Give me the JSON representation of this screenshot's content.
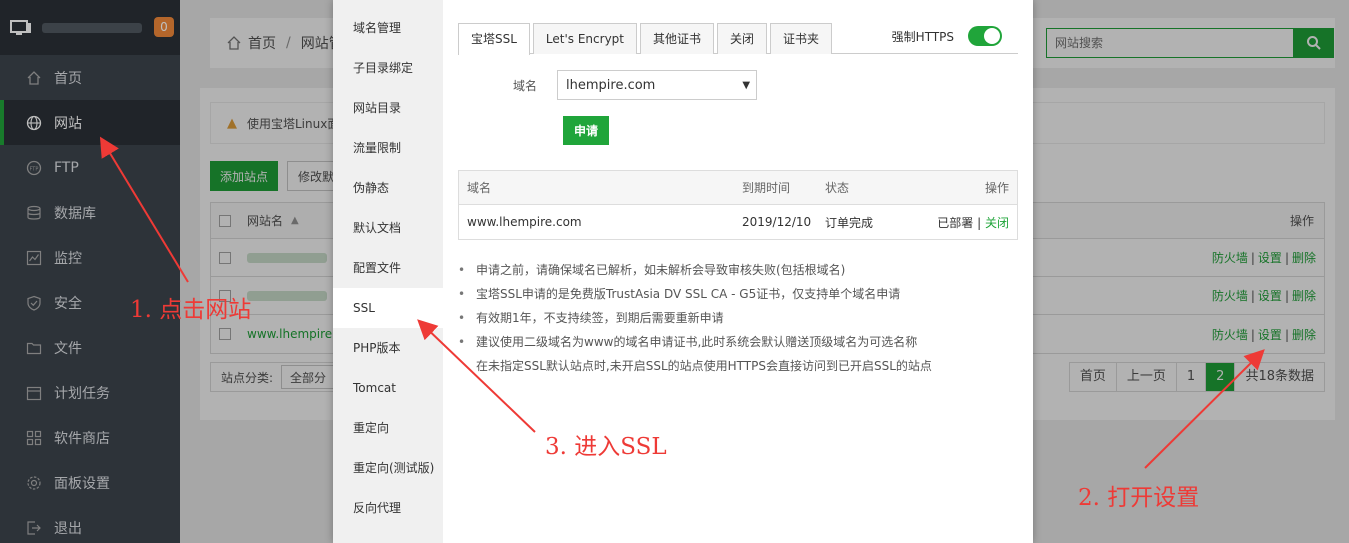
{
  "sidebar": {
    "badge": "0",
    "items": [
      {
        "label": "首页",
        "icon": "home-icon"
      },
      {
        "label": "网站",
        "icon": "globe-icon"
      },
      {
        "label": "FTP",
        "icon": "ftp-icon"
      },
      {
        "label": "数据库",
        "icon": "database-icon"
      },
      {
        "label": "监控",
        "icon": "monitor-icon"
      },
      {
        "label": "安全",
        "icon": "shield-icon"
      },
      {
        "label": "文件",
        "icon": "folder-icon"
      },
      {
        "label": "计划任务",
        "icon": "calendar-icon"
      },
      {
        "label": "软件商店",
        "icon": "grid-icon"
      },
      {
        "label": "面板设置",
        "icon": "gear-icon"
      },
      {
        "label": "退出",
        "icon": "logout-icon"
      }
    ]
  },
  "breadcrumb": {
    "home": "首页",
    "sep": "/",
    "current": "网站管"
  },
  "search": {
    "placeholder": "网站搜索"
  },
  "warning": {
    "text": "使用宝塔Linux面"
  },
  "buttons": {
    "add_site": "添加站点",
    "modify": "修改默"
  },
  "site_table": {
    "col_name": "网站名",
    "col_ops": "操作",
    "rows": [
      {
        "name": "",
        "ops": [
          "防火墙",
          "设置",
          "删除"
        ]
      },
      {
        "name": "",
        "ops": [
          "防火墙",
          "设置",
          "删除"
        ]
      },
      {
        "name": "www.lhempire.",
        "ops": [
          "防火墙",
          "设置",
          "删除"
        ]
      }
    ]
  },
  "category": {
    "label": "站点分类:",
    "value": "全部分"
  },
  "pager": {
    "first": "首页",
    "prev": "上一页",
    "p1": "1",
    "p2": "2",
    "total": "共18条数据"
  },
  "dialog": {
    "nav": [
      "域名管理",
      "子目录绑定",
      "网站目录",
      "流量限制",
      "伪静态",
      "默认文档",
      "配置文件",
      "SSL",
      "PHP版本",
      "Tomcat",
      "重定向",
      "重定向(测试版)",
      "反向代理"
    ],
    "tabs": [
      "宝塔SSL",
      "Let's Encrypt",
      "其他证书",
      "关闭",
      "证书夹"
    ],
    "force_https": "强制HTTPS",
    "domain_label": "域名",
    "domain_value": "lhempire.com",
    "apply": "申请",
    "cert_table": {
      "headers": {
        "domain": "域名",
        "expire": "到期时间",
        "status": "状态",
        "ops": "操作"
      },
      "row": {
        "domain": "www.lhempire.com",
        "expire": "2019/12/10",
        "status": "订单完成",
        "deployed": "已部署",
        "close": "关闭"
      }
    },
    "notes": [
      "申请之前，请确保域名已解析，如未解析会导致审核失败(包括根域名)",
      "宝塔SSL申请的是免费版TrustAsia DV SSL CA - G5证书，仅支持单个域名申请",
      "有效期1年，不支持续签，到期后需要重新申请",
      "建议使用二级域名为www的域名申请证书,此时系统会默认赠送顶级域名为可选名称",
      "在未指定SSL默认站点时,未开启SSL的站点使用HTTPS会直接访问到已开启SSL的站点"
    ]
  },
  "annotations": {
    "step1": "1. 点击网站",
    "step2": "2. 打开设置",
    "step3": "3. 进入SSL"
  },
  "colors": {
    "accent": "#20a53a",
    "annotation": "#ee3a36",
    "sidebar": "#3c444d"
  }
}
